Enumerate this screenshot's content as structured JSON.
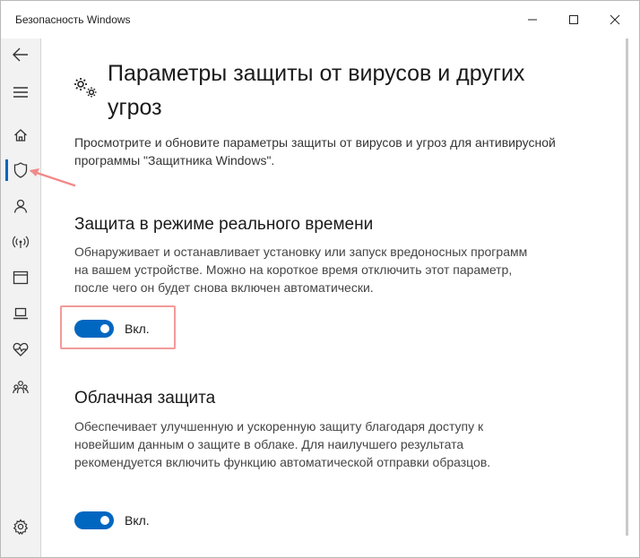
{
  "window": {
    "title": "Безопасность Windows",
    "accent_color": "#0067c0"
  },
  "sidebar": {
    "items": [
      {
        "id": "back",
        "icon": "back-arrow-icon"
      },
      {
        "id": "menu",
        "icon": "hamburger-menu-icon"
      },
      {
        "id": "home",
        "icon": "home-icon"
      },
      {
        "id": "virus-protection",
        "icon": "shield-icon",
        "active": true
      },
      {
        "id": "account",
        "icon": "person-icon"
      },
      {
        "id": "firewall",
        "icon": "wireless-signal-icon"
      },
      {
        "id": "app-browser",
        "icon": "browser-window-icon"
      },
      {
        "id": "device-security",
        "icon": "laptop-icon"
      },
      {
        "id": "device-health",
        "icon": "heart-pulse-icon"
      },
      {
        "id": "family",
        "icon": "family-icon"
      },
      {
        "id": "settings",
        "icon": "gear-icon"
      }
    ]
  },
  "page": {
    "title": "Параметры защиты от вирусов и других угроз",
    "description": "Просмотрите и обновите параметры защиты от вирусов и угроз для антивирусной программы \"Защитника Windows\"."
  },
  "sections": [
    {
      "title": "Защита в режиме реального времени",
      "description": "Обнаруживает и останавливает установку или запуск вредоносных программ на вашем устройстве. Можно на короткое время отключить этот параметр, после чего он будет снова включен автоматически.",
      "toggle_label": "Вкл.",
      "toggle_on": true
    },
    {
      "title": "Облачная защита",
      "description": "Обеспечивает улучшенную и ускоренную защиту благодаря доступу к новейшим данным о защите в облаке. Для наилучшего результата рекомендуется включить функцию автоматической отправки образцов.",
      "toggle_label": "Вкл.",
      "toggle_on": true
    }
  ],
  "annotations": {
    "highlight_color": "#f39a9a"
  }
}
